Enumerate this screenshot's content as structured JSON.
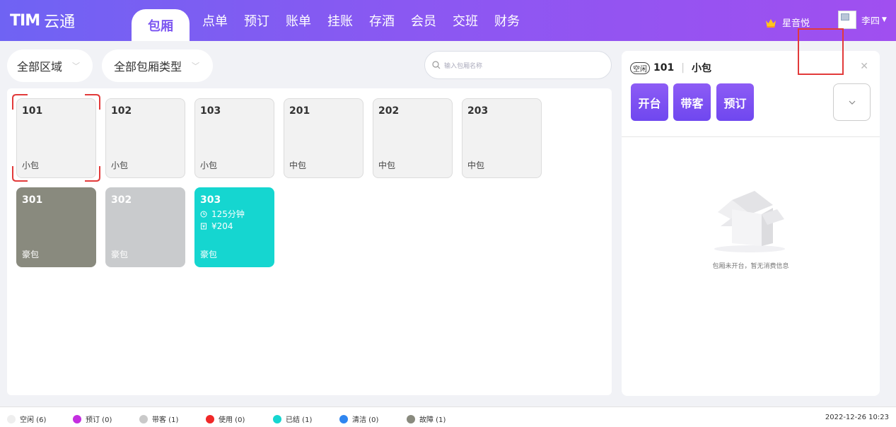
{
  "app": {
    "logo_mark": "TIM",
    "name": "云通"
  },
  "nav": {
    "active": "包厢",
    "items": [
      "点单",
      "预订",
      "账单",
      "挂账",
      "存酒",
      "会员",
      "交班",
      "财务"
    ]
  },
  "header": {
    "shop": "星音悦",
    "user": "李四"
  },
  "filters": {
    "area": "全部区域",
    "room_type": "全部包厢类型",
    "search_placeholder": "输入包厢名称"
  },
  "rooms": [
    {
      "no": "101",
      "type": "小包"
    },
    {
      "no": "102",
      "type": "小包"
    },
    {
      "no": "103",
      "type": "小包"
    },
    {
      "no": "201",
      "type": "中包"
    },
    {
      "no": "202",
      "type": "中包"
    },
    {
      "no": "203",
      "type": "中包"
    },
    {
      "no": "301",
      "type": "豪包"
    },
    {
      "no": "302",
      "type": "豪包"
    },
    {
      "no": "303",
      "type": "豪包",
      "duration": "125分钟",
      "amount": "¥204"
    }
  ],
  "detail": {
    "status": "空闲",
    "room_no": "101",
    "room_type": "小包",
    "actions": {
      "open": "开台",
      "guest": "带客",
      "reserve": "预订"
    },
    "empty_text": "包厢未开台，暂无消费信息"
  },
  "legend": [
    {
      "label": "空闲 (6)",
      "color": "#eeeeee"
    },
    {
      "label": "预订 (0)",
      "color": "#c42ee0"
    },
    {
      "label": "带客 (1)",
      "color": "#c9c9c9"
    },
    {
      "label": "使用 (0)",
      "color": "#f02828"
    },
    {
      "label": "已结 (1)",
      "color": "#15d6d0"
    },
    {
      "label": "清洁 (0)",
      "color": "#2f86f0"
    },
    {
      "label": "故障 (1)",
      "color": "#898a7e"
    }
  ],
  "datetime": "2022-12-26 10:23",
  "colors": {
    "brand_start": "#6f63f3",
    "brand_end": "#a04ff0",
    "accent": "#7d57f1",
    "highlight": "#e23a3a"
  }
}
